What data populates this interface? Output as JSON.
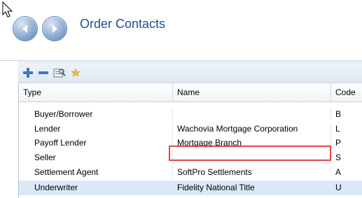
{
  "header": {
    "title": "Order Contacts"
  },
  "toolbar": {
    "icons": [
      "add-icon",
      "remove-icon",
      "lookup-icon",
      "favorite-star-icon"
    ]
  },
  "grid": {
    "columns": [
      "Type",
      "Name",
      "Code"
    ],
    "rows": [
      {
        "type": "Buyer/Borrower",
        "name": "",
        "code": "B"
      },
      {
        "type": "Lender",
        "name": "Wachovia Mortgage Corporation",
        "code": "L"
      },
      {
        "type": "Payoff Lender",
        "name": "Mortgage Branch",
        "code": "P"
      },
      {
        "type": "Seller",
        "name": "",
        "code": "S"
      },
      {
        "type": "Settlement Agent",
        "name": "SoftPro Settlements",
        "code": "A"
      },
      {
        "type": "Underwriter",
        "name": "Fidelity National Title",
        "code": "U"
      }
    ]
  },
  "colors": {
    "title": "#1f4f8b",
    "selected_row": "#dce8f7",
    "highlight": "#e04848"
  }
}
